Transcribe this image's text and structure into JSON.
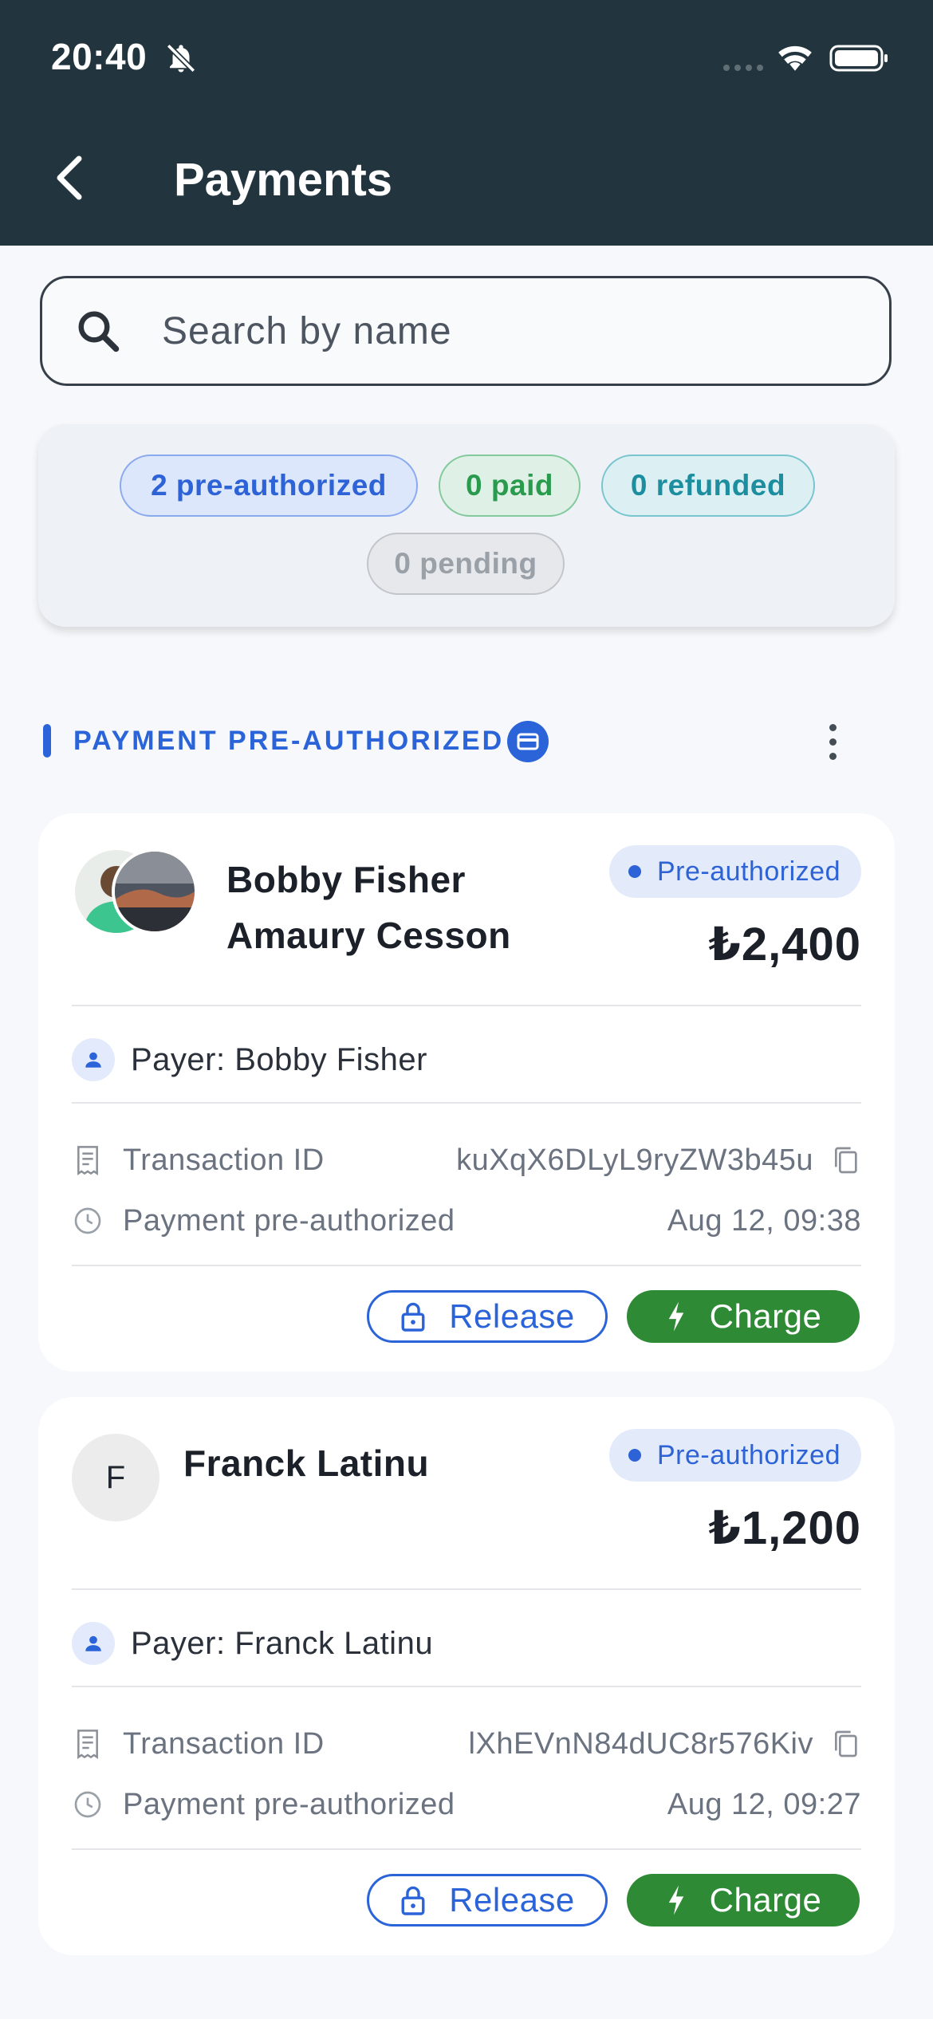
{
  "status_bar": {
    "time": "20:40"
  },
  "header": {
    "title": "Payments"
  },
  "search": {
    "placeholder": "Search by name"
  },
  "filters": {
    "pre_authorized": "2 pre-authorized",
    "paid": "0 paid",
    "refunded": "0 refunded",
    "pending": "0 pending"
  },
  "section": {
    "title": "PAYMENT PRE-AUTHORIZED"
  },
  "payments": [
    {
      "name_line1": "Bobby Fisher",
      "name_line2": "Amaury Cesson",
      "status": "Pre-authorized",
      "amount": "₺2,400",
      "payer": "Payer: Bobby Fisher",
      "transaction_label": "Transaction ID",
      "transaction_id": "kuXqX6DLyL9ryZW3b45u",
      "event_label": "Payment pre-authorized",
      "event_time": "Aug 12, 09:38",
      "release_label": "Release",
      "charge_label": "Charge"
    },
    {
      "avatar_initial": "F",
      "name_line1": "Franck Latinu",
      "status": "Pre-authorized",
      "amount": "₺1,200",
      "payer": "Payer: Franck Latinu",
      "transaction_label": "Transaction ID",
      "transaction_id": "lXhEVnN84dUC8r576Kiv",
      "event_label": "Payment pre-authorized",
      "event_time": "Aug 12, 09:27",
      "release_label": "Release",
      "charge_label": "Charge"
    }
  ],
  "colors": {
    "header_bg": "#22343d",
    "accent_blue": "#2b64d9",
    "charge_green": "#2e8a35"
  }
}
